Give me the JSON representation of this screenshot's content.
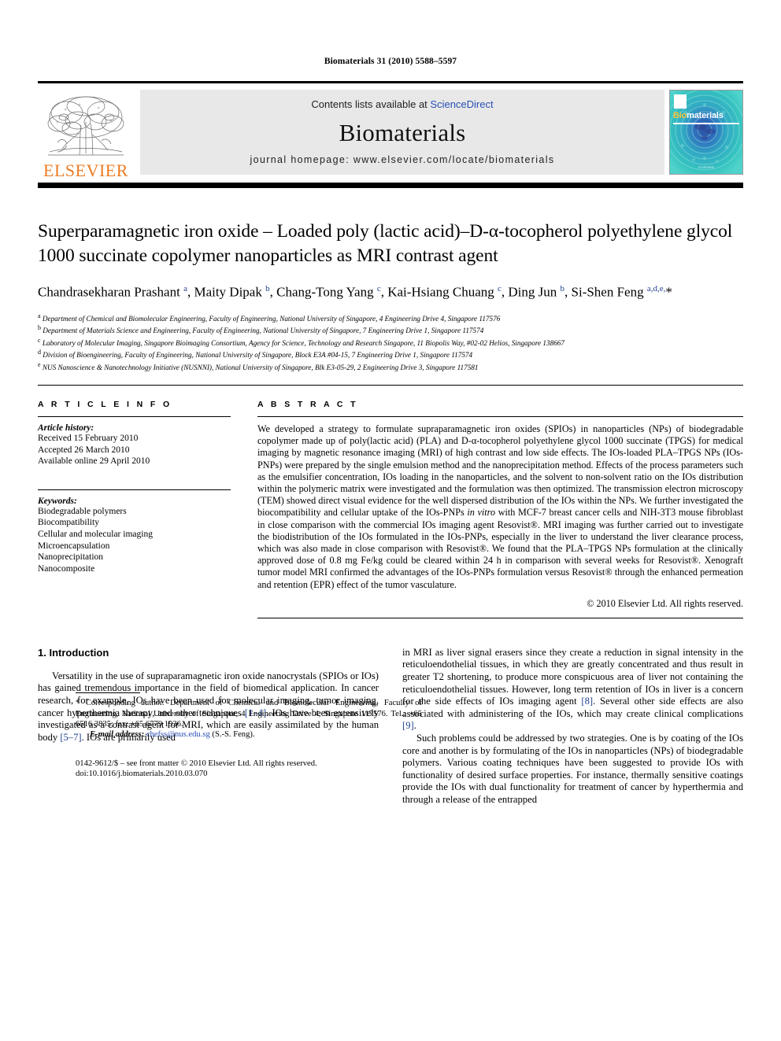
{
  "running_head": "Biomaterials 31 (2010) 5588–5597",
  "masthead": {
    "publisher_name": "ELSEVIER",
    "contents_prefix": "Contents lists available at ",
    "sciencedirect": "ScienceDirect",
    "journal_title": "Biomaterials",
    "homepage": "journal homepage: www.elsevier.com/locate/biomaterials",
    "cover": {
      "brand_bio": "Bio",
      "brand_materials": "materials",
      "footer": "ELSEVIER"
    },
    "link_color": "#2a4fb5",
    "accent_color": "#ec7b22",
    "cover_color": "#2fb7b2"
  },
  "article": {
    "title": "Superparamagnetic iron oxide – Loaded poly (lactic acid)–D-α-tocopherol polyethylene glycol 1000 succinate copolymer nanoparticles as MRI contrast agent",
    "authors_html": "Chandrasekharan Prashant <sup>a</sup>, Maity Dipak <sup>b</sup>, Chang-Tong Yang <sup>c</sup>, Kai-Hsiang Chuang <sup>c</sup>, Ding Jun <sup>b</sup>, Si-Shen Feng <sup>a,d,e,</sup>*",
    "affiliations": [
      "a Department of Chemical and Biomolecular Engineering, Faculty of Engineering, National University of Singapore, 4 Engineering Drive 4, Singapore 117576",
      "b Department of Materials Science and Engineering, Faculty of Engineering, National University of Singapore, 7 Engineering Drive 1, Singapore 117574",
      "c Laboratory of Molecular Imaging, Singapore Bioimaging Consortium, Agency for Science, Technology and Research Singapore, 11 Biopolis Way, #02-02 Helios, Singapore 138667",
      "d Division of Bioengineering, Faculty of Engineering, National University of Singapore, Block E3A #04-15, 7 Engineering Drive 1, Singapore 117574",
      "e NUS Nanoscience & Nanotechnology Initiative (NUSNNI), National University of Singapore, Blk E3-05-29, 2 Engineering Drive 3, Singapore 117581"
    ]
  },
  "article_info": {
    "heading": "A R T I C L E   I N F O",
    "history_label": "Article history:",
    "history": [
      "Received 15 February 2010",
      "Accepted 26 March 2010",
      "Available online 29 April 2010"
    ],
    "keywords_label": "Keywords:",
    "keywords": [
      "Biodegradable polymers",
      "Biocompatibility",
      "Cellular and molecular imaging",
      "Microencapsulation",
      "Nanoprecipitation",
      "Nanocomposite"
    ]
  },
  "abstract": {
    "heading": "A B S T R A C T",
    "paragraph_1": "We developed a strategy to formulate supraparamagnetic iron oxides (SPIOs) in nanoparticles (NPs) of biodegradable copolymer made up of poly(lactic acid) (PLA) and D-α-tocopherol polyethylene glycol 1000 succinate (TPGS) for medical imaging by magnetic resonance imaging (MRI) of high contrast and low side effects. The IOs-loaded PLA–TPGS NPs (IOs-PNPs) were prepared by the single emulsion method and the nanoprecipitation method. Effects of the process parameters such as the emulsifier concentration, IOs loading in the nanoparticles, and the solvent to non-solvent ratio on the IOs distribution within the polymeric matrix were investigated and the formulation was then optimized. The transmission electron microscopy (TEM) showed direct visual evidence for the well dispersed distribution of the IOs within the NPs. We further investigated the biocompatibility and cellular uptake of the IOs-PNPs ",
    "italic_1": "in vitro",
    "paragraph_2": " with MCF-7 breast cancer cells and NIH-3T3 mouse fibroblast in close comparison with the commercial IOs imaging agent Resovist®. MRI imaging was further carried out to investigate the biodistribution of the IOs formulated in the IOs-PNPs, especially in the liver to understand the liver clearance process, which was also made in close comparison with Resovist®. We found that the PLA–TPGS NPs formulation at the clinically approved dose of 0.8 mg Fe/kg could be cleared within 24 h in comparison with several weeks for Resovist®. Xenograft tumor model MRI confirmed the advantages of the IOs-PNPs formulation versus Resovist® through the enhanced permeation and retention (EPR) effect of the tumor vasculature.",
    "copyright": "© 2010 Elsevier Ltd. All rights reserved."
  },
  "body": {
    "section_number_title": "1.  Introduction",
    "left_paragraph_1_a": "Versatility in the use of supraparamagnetic iron oxide nanocrystals (SPIOs or IOs) has gained tremendous importance in the field of biomedical application. In cancer research, for example, IOs have been used for molecular imaging, tumor imaging, cancer hyperthermia therapy, and other techniques ",
    "ref_1_4": "[1–4]",
    "left_paragraph_1_b": ". IOs have been extensively investigated as a contrast agent for MRI, which are easily assimilated by the human body ",
    "ref_5_7": "[5–7]",
    "left_paragraph_1_c": ". IOs are primarily used",
    "right_paragraph_1_a": "in MRI as liver signal erasers since they create a reduction in signal intensity in the reticuloendothelial tissues, in which they are greatly concentrated and thus result in greater T2 shortening, to produce more conspicuous area of liver not containing the reticuloendothelial tissues. However, long term retention of IOs in liver is a concern for the side effects of IOs imaging agent ",
    "ref_8": "[8]",
    "right_paragraph_1_b": ". Several other side effects are also associated with administering of the IOs, which may create clinical complications ",
    "ref_9": "[9]",
    "right_paragraph_1_c": ".",
    "right_paragraph_2": "Such problems could be addressed by two strategies. One is by coating of the IOs core and another is by formulating of the IOs in nanoparticles (NPs) of biodegradable polymers. Various coating techniques have been suggested to provide IOs with functionality of desired surface properties. For instance, thermally sensitive coatings provide the IOs with dual functionality for treatment of cancer by hyperthermia and through a release of the entrapped"
  },
  "footnotes": {
    "corresponding_marker": "*",
    "corresponding_text": " Corresponding author. Department of Chemical and Biomolecular Engineering, Faculty of Engineering, National University of Singapore, 4 Engineering Drive 4, Singapore 117576. Tel.: +65 6516 3835; fax: +65 6779 1936.",
    "email_label": "E-mail address:",
    "email": "chefss@nus.edu.sg",
    "email_suffix": " (S.-S. Feng).",
    "issn_line": "0142-9612/$ – see front matter © 2010 Elsevier Ltd. All rights reserved.",
    "doi_line": "doi:10.1016/j.biomaterials.2010.03.070"
  }
}
